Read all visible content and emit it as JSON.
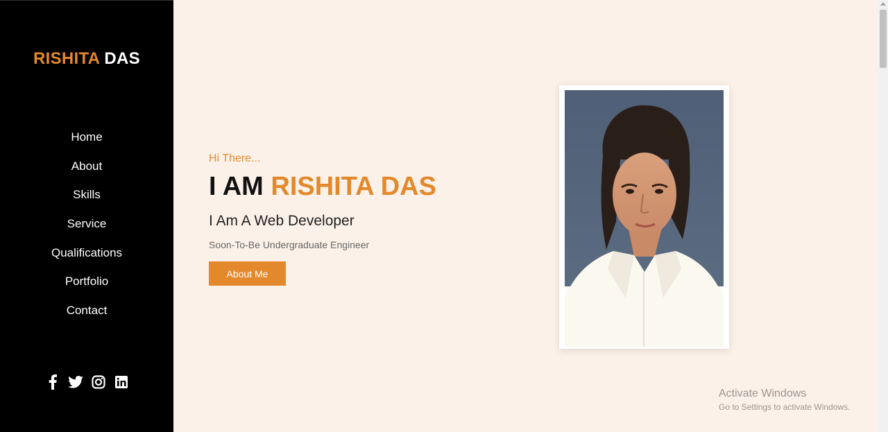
{
  "colors": {
    "accent": "#e3892c",
    "sidebar_bg": "#000000",
    "page_bg": "#fcf1e8"
  },
  "brand": {
    "first": "RISHITA",
    "last": "DAS"
  },
  "nav": {
    "items": [
      {
        "label": "Home"
      },
      {
        "label": "About"
      },
      {
        "label": "Skills"
      },
      {
        "label": "Service"
      },
      {
        "label": "Qualifications"
      },
      {
        "label": "Portfolio"
      },
      {
        "label": "Contact"
      }
    ]
  },
  "social": [
    "facebook-icon",
    "twitter-icon",
    "instagram-icon",
    "linkedin-icon"
  ],
  "hero": {
    "greeting": "Hi There...",
    "prefix": "I AM",
    "name": "RISHITA DAS",
    "role": "I Am A Web Developer",
    "subrole": "Soon-To-Be Undergraduate Engineer",
    "button": "About Me"
  },
  "watermark": {
    "title": "Activate Windows",
    "subtitle": "Go to Settings to activate Windows."
  }
}
